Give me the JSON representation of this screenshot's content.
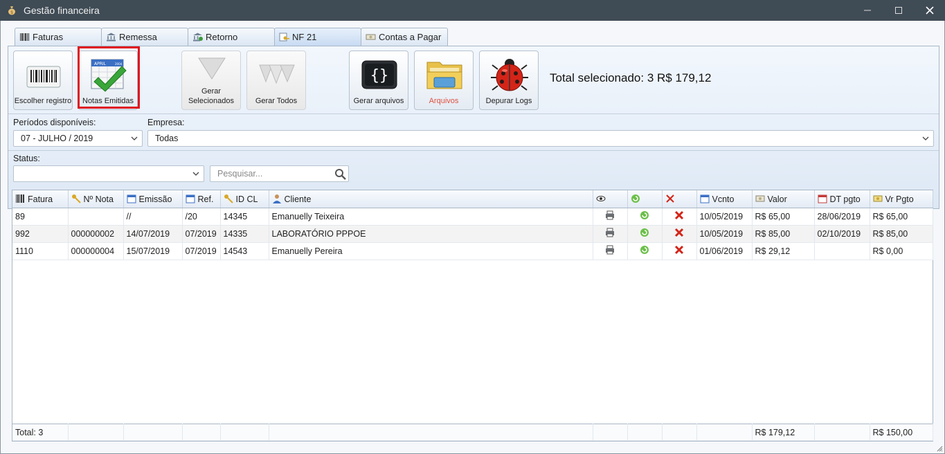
{
  "window": {
    "title": "Gestão financeira"
  },
  "tabs": [
    {
      "label": "Faturas",
      "icon": "barcode-icon"
    },
    {
      "label": "Remessa",
      "icon": "bank-icon"
    },
    {
      "label": "Retorno",
      "icon": "bank-return-icon"
    },
    {
      "label": "NF 21",
      "icon": "key-document-icon"
    },
    {
      "label": "Contas a Pagar",
      "icon": "money-icon"
    }
  ],
  "toolbar": {
    "escolher_registro": "Escolher registro",
    "notas_emitidas": "Notas Emitidas",
    "gerar_selecionados_1": "Gerar",
    "gerar_selecionados_2": "Selecionados",
    "gerar_todos": "Gerar Todos",
    "gerar_arquivos": "Gerar arquivos",
    "arquivos": "Arquivos",
    "depurar_logs": "Depurar Logs",
    "calendar_text": "APRIL",
    "calendar_year": "2004"
  },
  "total_selecionado": "Total selecionado: 3 R$ 179,12",
  "filters": {
    "periodos_label": "Períodos disponíveis:",
    "periodos_value": "07 - JULHO / 2019",
    "empresa_label": "Empresa:",
    "empresa_value": "Todas",
    "status_label": "Status:",
    "status_value": "",
    "search_placeholder": "Pesquisar..."
  },
  "table": {
    "headers": [
      "Fatura",
      "Nº Nota",
      "Emissão",
      "Ref.",
      "ID CL",
      "Cliente",
      "",
      "",
      "",
      "Vcnto",
      "Valor",
      "DT pgto",
      "Vr Pgto"
    ],
    "rows": [
      [
        "89",
        "",
        "//",
        "/20",
        "14345",
        "Emanuelly Teixeira",
        "10/05/2019",
        "R$ 65,00",
        "28/06/2019",
        "R$ 65,00"
      ],
      [
        "992",
        "000000002",
        "14/07/2019",
        "07/2019",
        "14335",
        "LABORATÓRIO PPPOE",
        "10/05/2019",
        "R$ 85,00",
        "02/10/2019",
        "R$ 85,00"
      ],
      [
        "1110",
        "000000004",
        "15/07/2019",
        "07/2019",
        "14543",
        "Emanuelly Pereira",
        "01/06/2019",
        "R$ 29,12",
        "",
        "R$ 0,00"
      ]
    ],
    "footer": {
      "total": "Total: 3",
      "valor": "R$ 179,12",
      "vr_pgto": "R$ 150,00"
    }
  },
  "colors": {
    "title_bar": "#3f4b55",
    "highlight": "#e0141e",
    "panel": "#dde8f5"
  }
}
